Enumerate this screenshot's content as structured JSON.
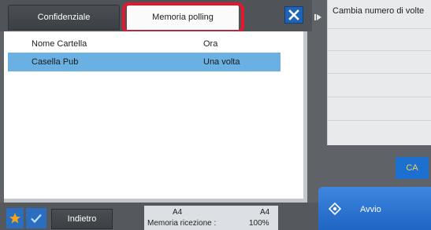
{
  "tabs": {
    "inactive_label": "Confidenziale",
    "active_label": "Memoria polling"
  },
  "table": {
    "columns": [
      "Nome Cartella",
      "Ora"
    ],
    "rows": [
      {
        "name": "Casella Pub",
        "time": "Una volta"
      }
    ]
  },
  "side_panel": {
    "header": "Cambia numero di volte"
  },
  "buttons": {
    "ca": "CA",
    "start": "Avvio",
    "back": "Indietro"
  },
  "status": {
    "paper_left": "A4",
    "paper_right": "A4",
    "memory_label": "Memoria ricezione :",
    "memory_value": "100%"
  },
  "colors": {
    "accent_blue": "#1f65c2",
    "selected_row": "#6ab0e2",
    "highlight_red": "#e1192c",
    "ca_text": "#f3d54b"
  },
  "icons": [
    "close-icon",
    "expand-arrow-icon",
    "star-icon",
    "checkmark-icon",
    "start-diamond-icon"
  ]
}
